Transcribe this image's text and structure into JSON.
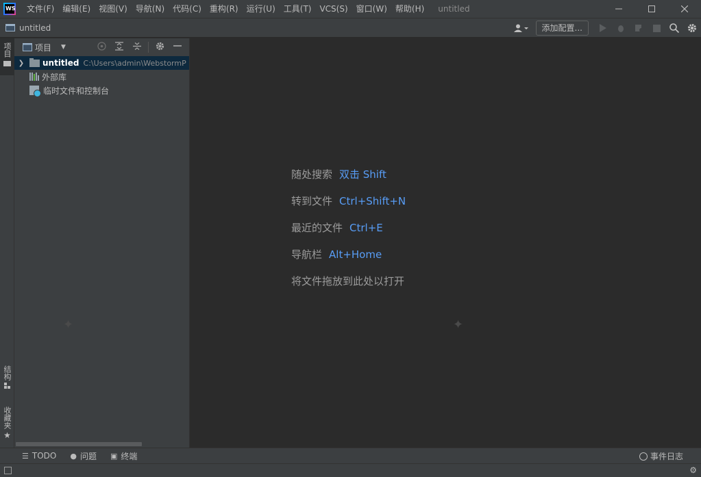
{
  "app": {
    "logo_text": "WS",
    "menu": [
      "文件(F)",
      "编辑(E)",
      "视图(V)",
      "导航(N)",
      "代码(C)",
      "重构(R)",
      "运行(U)",
      "工具(T)",
      "VCS(S)",
      "窗口(W)",
      "帮助(H)"
    ],
    "window_title": "untitled"
  },
  "navbar": {
    "project_name": "untitled",
    "add_config_label": "添加配置..."
  },
  "left_stripe": {
    "project_tab": "项目",
    "structure_tab": "结构",
    "favorites_tab": "收藏夹"
  },
  "project_panel": {
    "title": "项目",
    "tree": [
      {
        "name": "untitled",
        "path": "C:\\Users\\admin\\WebstormP"
      },
      {
        "name": "外部库"
      },
      {
        "name": "临时文件和控制台"
      }
    ]
  },
  "editor": {
    "hints": [
      {
        "label": "随处搜索",
        "key": "双击 Shift"
      },
      {
        "label": "转到文件",
        "key": "Ctrl+Shift+N"
      },
      {
        "label": "最近的文件",
        "key": "Ctrl+E"
      },
      {
        "label": "导航栏",
        "key": "Alt+Home"
      },
      {
        "label": "将文件拖放到此处以打开",
        "key": ""
      }
    ]
  },
  "bottom_bar": {
    "todo": "TODO",
    "problems": "问题",
    "terminal": "终端",
    "event_log": "事件日志"
  },
  "colors": {
    "accent_key": "#589df6",
    "background": "#2b2b2b",
    "panel": "#3c3f41",
    "selection": "#0d293e"
  }
}
